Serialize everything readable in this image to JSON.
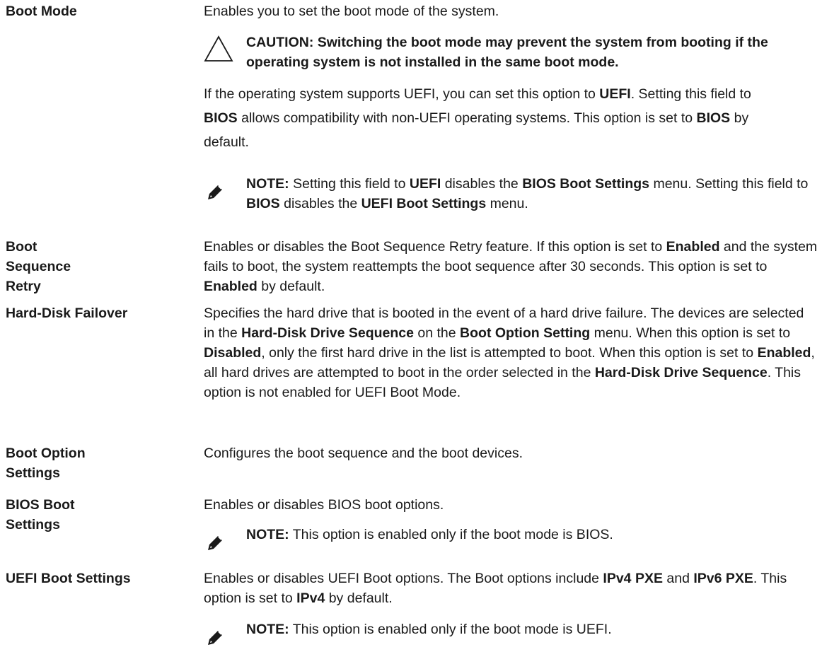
{
  "entries": [
    {
      "term": "Boot Mode",
      "description": [
        {
          "t": "Enables you to set the boot mode of the system."
        }
      ],
      "caution": "CAUTION: Switching the boot mode may prevent the system from booting if the operating system is not installed in the same boot mode.",
      "extra": [
        {
          "t": "If the operating system supports UEFI, you can set this option to "
        },
        {
          "t": "UEFI",
          "b": true
        },
        {
          "t": ". Setting this field to "
        },
        {
          "t": "BIOS",
          "b": true
        },
        {
          "t": " allows compatibility with non-UEFI operating systems. This option is set to "
        },
        {
          "t": "BIOS",
          "b": true
        },
        {
          "t": " by default."
        }
      ],
      "note": {
        "label": "NOTE:",
        "segments": [
          {
            "t": " Setting this field to "
          },
          {
            "t": "UEFI",
            "b": true
          },
          {
            "t": " disables the "
          },
          {
            "t": "BIOS Boot Settings",
            "b": true
          },
          {
            "t": " menu. Setting this field to "
          },
          {
            "t": "BIOS",
            "b": true
          },
          {
            "t": " disables the "
          },
          {
            "t": "UEFI Boot Settings",
            "b": true
          },
          {
            "t": " menu."
          }
        ]
      }
    },
    {
      "term": "Boot Sequence Retry",
      "description": [
        {
          "t": "Enables or disables the Boot Sequence Retry feature. If this option is set to "
        },
        {
          "t": "Enabled",
          "b": true
        },
        {
          "t": " and the system fails to boot, the system reattempts the boot sequence after 30 seconds. This option is set to "
        },
        {
          "t": "Enabled",
          "b": true
        },
        {
          "t": " by default."
        }
      ]
    },
    {
      "term": "Hard-Disk Failover",
      "description": [
        {
          "t": "Specifies the hard drive that is booted in the event of a hard drive failure. The devices are selected in the "
        },
        {
          "t": "Hard-Disk Drive Sequence",
          "b": true
        },
        {
          "t": " on the "
        },
        {
          "t": "Boot Option Setting",
          "b": true
        },
        {
          "t": " menu. When this option is set to "
        },
        {
          "t": "Disabled",
          "b": true
        },
        {
          "t": ", only the first hard drive in the list is attempted to boot. When this option is set to "
        },
        {
          "t": "Enabled",
          "b": true
        },
        {
          "t": ", all hard drives are attempted to boot in the order selected in the "
        },
        {
          "t": "Hard-Disk Drive Sequence",
          "b": true
        },
        {
          "t": ". This option is not enabled for UEFI Boot Mode."
        }
      ]
    },
    {
      "term": "Boot Option Settings",
      "description": [
        {
          "t": "Configures the boot sequence and the boot devices."
        }
      ]
    },
    {
      "term": "BIOS Boot Settings",
      "description": [
        {
          "t": "Enables or disables BIOS boot options."
        }
      ],
      "note": {
        "label": "NOTE:",
        "segments": [
          {
            "t": " This option is enabled only if the boot mode is BIOS."
          }
        ]
      }
    },
    {
      "term": "UEFI Boot Settings",
      "description": [
        {
          "t": "Enables or disables UEFI Boot options. The Boot options include "
        },
        {
          "t": "IPv4 PXE",
          "b": true
        },
        {
          "t": " and "
        },
        {
          "t": "IPv6 PXE",
          "b": true
        },
        {
          "t": ". This option is set to "
        },
        {
          "t": "IPv4",
          "b": true
        },
        {
          "t": " by default."
        }
      ],
      "note": {
        "label": "NOTE:",
        "segments": [
          {
            "t": " This option is enabled only if the boot mode is UEFI."
          }
        ]
      }
    }
  ],
  "icons": {
    "caution": "caution-triangle-icon",
    "note": "pencil-note-icon"
  },
  "colors": {
    "text": "#1a1a1a",
    "icon": "#1a1a1a"
  }
}
